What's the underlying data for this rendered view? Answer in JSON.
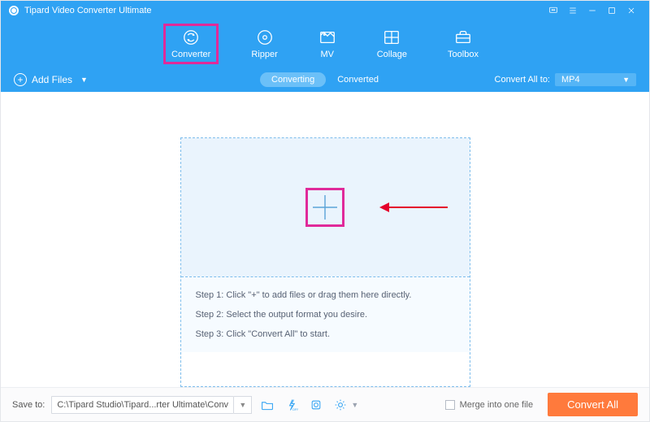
{
  "title": "Tipard Video Converter Ultimate",
  "nav": {
    "items": [
      {
        "label": "Converter",
        "selected": true
      },
      {
        "label": "Ripper",
        "selected": false
      },
      {
        "label": "MV",
        "selected": false
      },
      {
        "label": "Collage",
        "selected": false
      },
      {
        "label": "Toolbox",
        "selected": false
      }
    ]
  },
  "toolrow": {
    "add_files_label": "Add Files",
    "segment": {
      "converting": "Converting",
      "converted": "Converted"
    },
    "convert_all_label": "Convert All to:",
    "convert_all_format": "MP4"
  },
  "dropzone": {
    "step1": "Step 1: Click \"+\" to add files or drag them here directly.",
    "step2": "Step 2: Select the output format you desire.",
    "step3": "Step 3: Click \"Convert All\" to start."
  },
  "bottom": {
    "save_to_label": "Save to:",
    "path": "C:\\Tipard Studio\\Tipard...rter Ultimate\\Converted",
    "merge_label": "Merge into one file",
    "convert_all_button": "Convert All"
  }
}
